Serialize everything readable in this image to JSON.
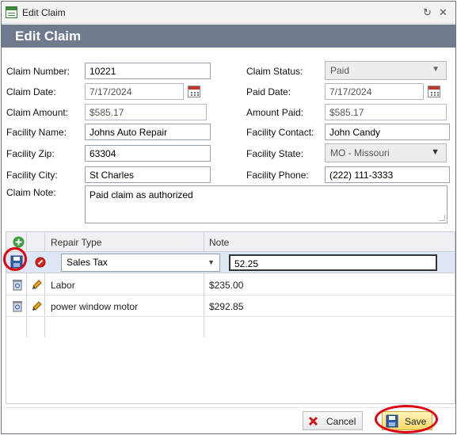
{
  "window": {
    "title": "Edit Claim"
  },
  "header": {
    "title": "Edit Claim"
  },
  "form": {
    "claim_number": {
      "label": "Claim Number:",
      "value": "10221"
    },
    "claim_status": {
      "label": "Claim Status:",
      "value": "Paid"
    },
    "claim_date": {
      "label": "Claim Date:",
      "value": "7/17/2024"
    },
    "paid_date": {
      "label": "Paid Date:",
      "value": "7/17/2024"
    },
    "claim_amount": {
      "label": "Claim Amount:",
      "value": "$585.17"
    },
    "amount_paid": {
      "label": "Amount Paid:",
      "value": "$585.17"
    },
    "facility_name": {
      "label": "Facility Name:",
      "value": "Johns Auto Repair"
    },
    "facility_contact": {
      "label": "Facility Contact:",
      "value": "John Candy"
    },
    "facility_zip": {
      "label": "Facility Zip:",
      "value": "63304"
    },
    "facility_state": {
      "label": "Facility State:",
      "value": "MO - Missouri"
    },
    "facility_city": {
      "label": "Facility City:",
      "value": "St Charles"
    },
    "facility_phone": {
      "label": "Facility Phone:",
      "value": "(222) 111-3333"
    },
    "claim_note": {
      "label": "Claim Note:",
      "value": "Paid claim as authorized"
    }
  },
  "grid": {
    "columns": [
      "Repair Type",
      "Note"
    ],
    "edit_row": {
      "repair_type": "Sales Tax",
      "note": "52.25"
    },
    "rows": [
      {
        "repair_type": "Labor",
        "note": "$235.00"
      },
      {
        "repair_type": "power window motor",
        "note": "$292.85"
      }
    ]
  },
  "buttons": {
    "cancel": "Cancel",
    "save": "Save"
  },
  "colors": {
    "header_bg": "#6f7a8f",
    "highlight_ring": "#e00010",
    "edit_row_bg": "#dde7f4"
  }
}
